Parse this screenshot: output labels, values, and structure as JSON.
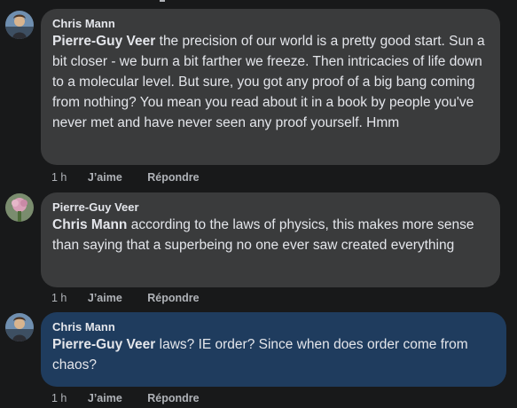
{
  "comments": [
    {
      "author": "Chris Mann",
      "mention": "Pierre-Guy Veer",
      "text": " the precision of our world is a pretty good start. Sun a bit closer - we burn a bit farther we freeze. Then intricacies of life down to a molecular level. But sure, you got any proof of a big bang coming from nothing? You mean you read about it in a book by people you've never met and have never seen any proof yourself. Hmm",
      "time": "1 h",
      "like": "J’aime",
      "reply": "Répondre",
      "avatar_icon": "profile-photo-avatar",
      "bubble_color": "#3a3b3c"
    },
    {
      "author": "Pierre-Guy Veer",
      "mention": "Chris Mann",
      "text": " according to the laws of physics, this makes more sense than saying that a superbeing no one ever saw created everything",
      "time": "1 h",
      "like": "J’aime",
      "reply": "Répondre",
      "avatar_icon": "profile-photo-avatar",
      "bubble_color": "#3a3b3c"
    },
    {
      "author": "Chris Mann",
      "mention": "Pierre-Guy Veer",
      "text": " laws? IE order? Since when does order come from chaos?",
      "time": "1 h",
      "like": "J’aime",
      "reply": "Répondre",
      "avatar_icon": "profile-photo-avatar",
      "bubble_color": "#1f3c5e"
    }
  ]
}
